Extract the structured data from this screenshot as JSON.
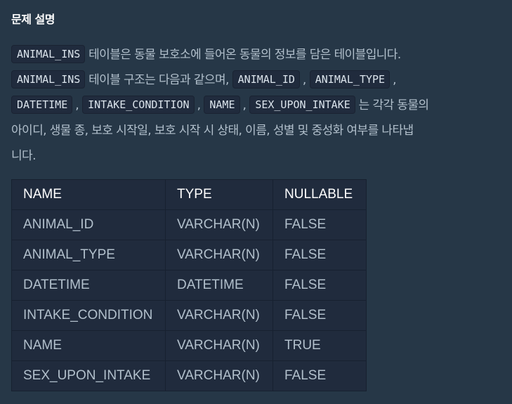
{
  "section_title": "문제 설명",
  "description": {
    "line1": {
      "chip": "ANIMAL_INS",
      "text": "테이블은 동물 보호소에 들어온 동물의 정보를 담은 테이블입니다."
    },
    "line2": {
      "chip": "ANIMAL_INS",
      "text": "테이블 구조는 다음과 같으며,",
      "chips": [
        "ANIMAL_ID",
        "ANIMAL_TYPE"
      ],
      "separator": ","
    },
    "line3": {
      "chips": [
        "DATETIME",
        "INTAKE_CONDITION",
        "NAME",
        "SEX_UPON_INTAKE"
      ],
      "separator": ",",
      "text": "는 각각 동물의"
    },
    "line4": "아이디, 생물 종, 보호 시작일, 보호 시작 시 상태, 이름, 성별 및 중성화 여부를 나타냅",
    "line5": "니다."
  },
  "table": {
    "headers": [
      "NAME",
      "TYPE",
      "NULLABLE"
    ],
    "rows": [
      [
        "ANIMAL_ID",
        "VARCHAR(N)",
        "FALSE"
      ],
      [
        "ANIMAL_TYPE",
        "VARCHAR(N)",
        "FALSE"
      ],
      [
        "DATETIME",
        "DATETIME",
        "FALSE"
      ],
      [
        "INTAKE_CONDITION",
        "VARCHAR(N)",
        "FALSE"
      ],
      [
        "NAME",
        "VARCHAR(N)",
        "TRUE"
      ],
      [
        "SEX_UPON_INTAKE",
        "VARCHAR(N)",
        "FALSE"
      ]
    ]
  }
}
